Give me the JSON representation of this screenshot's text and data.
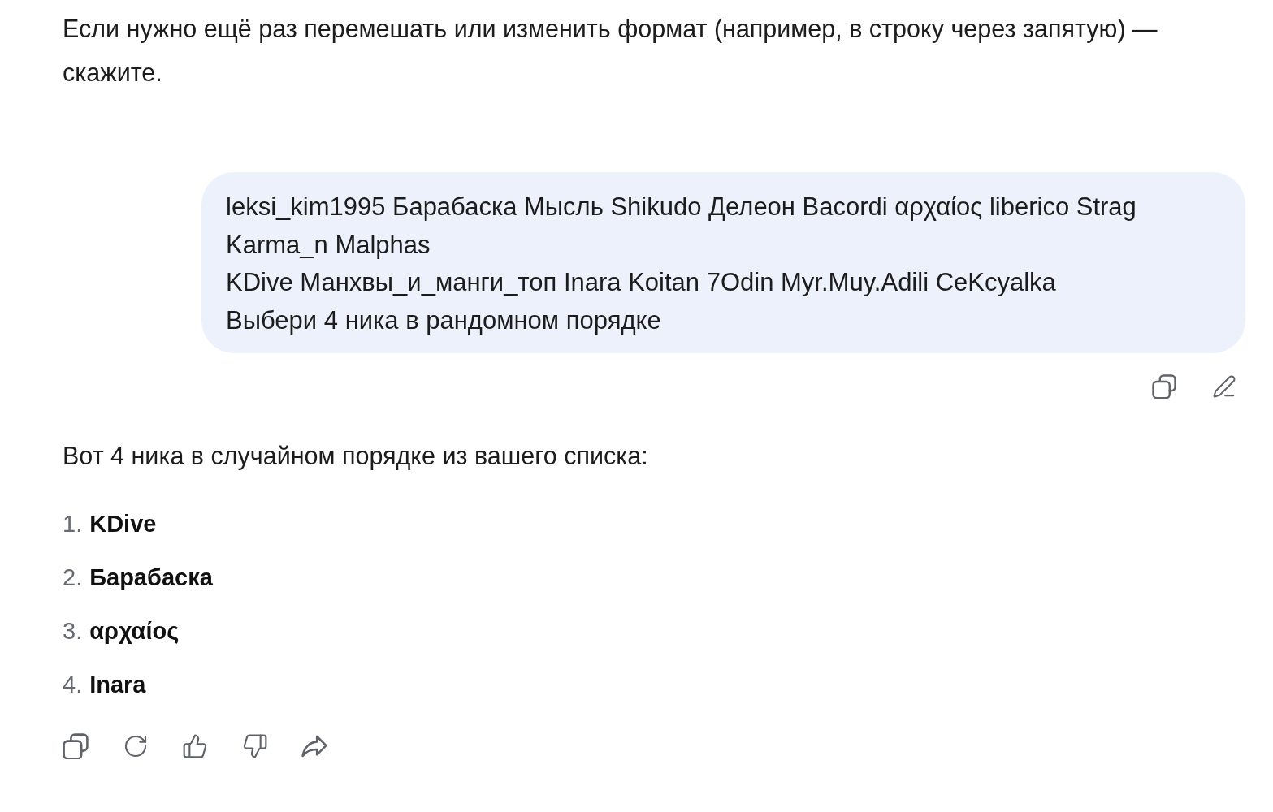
{
  "previous_reply": {
    "text": "Если нужно ещё раз перемешать или изменить формат (например, в строку через запятую) — скажите."
  },
  "user_message": {
    "lines": [
      "leksi_kim1995 Барабаска Мысль Shikudo Делеон Bacordi αρχαίος liberico Strag Karma_n Malphas",
      "KDive Манхвы_и_манги_топ Inara Koitan 7Odin Myr.Muy.Adili CeKcyalka",
      "Выбери 4 ника в рандомном порядке"
    ],
    "actions": [
      {
        "kind": "copy"
      },
      {
        "kind": "edit"
      }
    ]
  },
  "assistant_reply": {
    "intro": "Вот 4 ника в случайном порядке из вашего списка:",
    "items": [
      {
        "number": "1.",
        "name": "KDive"
      },
      {
        "number": "2.",
        "name": "Барабаска"
      },
      {
        "number": "3.",
        "name": "αρχαίος"
      },
      {
        "number": "4.",
        "name": "Inara"
      }
    ],
    "actions": [
      {
        "kind": "copy"
      },
      {
        "kind": "regenerate"
      },
      {
        "kind": "like"
      },
      {
        "kind": "dislike"
      },
      {
        "kind": "share"
      }
    ]
  }
}
